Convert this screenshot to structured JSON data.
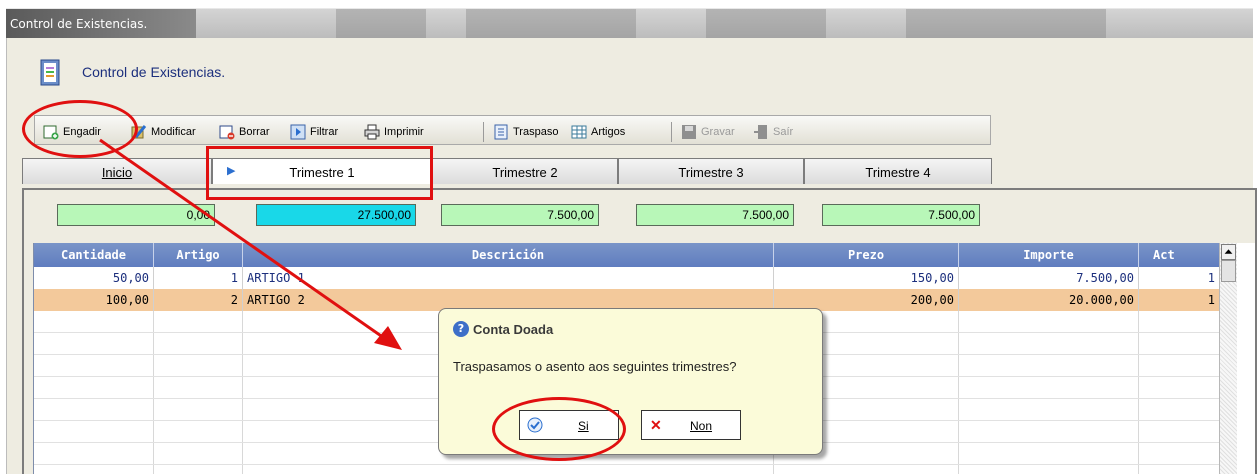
{
  "window": {
    "title": "Control de Existencias."
  },
  "header": {
    "title": "Control de Existencias.",
    "icon": "document-list-icon"
  },
  "toolbar": {
    "add": "Engadir",
    "modify": "Modificar",
    "delete": "Borrar",
    "filter": "Filtrar",
    "print": "Imprimir",
    "transfer": "Traspaso",
    "articles": "Artigos",
    "save": "Gravar",
    "exit": "Saír"
  },
  "tabs": [
    "Inicio",
    "Trimestre 1",
    "Trimestre 2",
    "Trimestre 3",
    "Trimestre 4"
  ],
  "totals": [
    "0,00",
    "27.500,00",
    "7.500,00",
    "7.500,00",
    "7.500,00"
  ],
  "grid": {
    "columns": [
      "Cantidade",
      "Artigo",
      "Descrición",
      "Prezo",
      "Importe",
      "Act"
    ],
    "rows": [
      [
        "50,00",
        "1",
        "ARTIGO 1",
        "150,00",
        "7.500,00",
        "1"
      ],
      [
        "100,00",
        "2",
        "ARTIGO 2",
        "200,00",
        "20.000,00",
        "1"
      ]
    ]
  },
  "dialog": {
    "title": "Conta Doada",
    "message": "Traspasamos o asento aos seguintes trimestres?",
    "yes": "Si",
    "no": "Non"
  },
  "colors": {
    "accent": "#1c2f7d",
    "grid_header": "#6f8bc6",
    "selected_row": "#f3c99b",
    "total_active": "#19d8e8",
    "total": "#b8f7b8",
    "annotation": "#e01010"
  }
}
